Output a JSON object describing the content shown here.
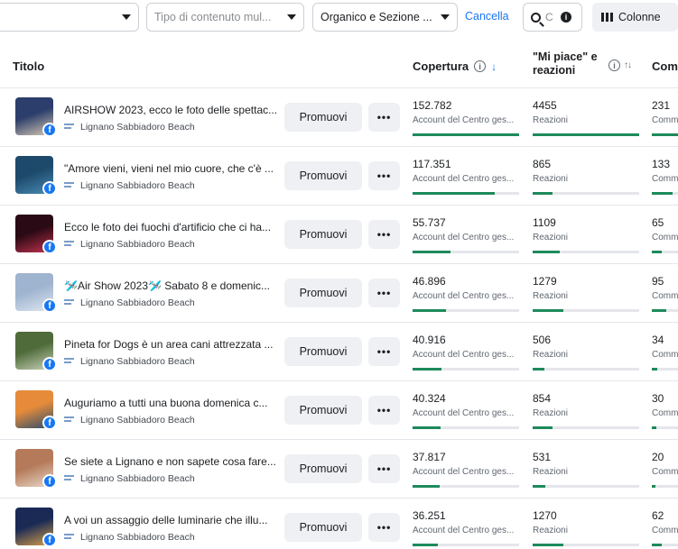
{
  "toolbar": {
    "dropdown1": "",
    "dropdown2": "Tipo di contenuto mul...",
    "dropdown3": "Organico e Sezione ...",
    "cancel": "Cancella",
    "search_placeholder": "Cerca",
    "columns": "Colonne"
  },
  "header": {
    "title": "Titolo",
    "coverage": "Copertura",
    "likes": "\"Mi piace\" e reazioni",
    "comments": "Commenti"
  },
  "labels": {
    "promote": "Promuovi",
    "more": "•••",
    "coverage_sub": "Account del Centro ges...",
    "likes_sub": "Reazioni",
    "comments_sub": "Commenti"
  },
  "rows": [
    {
      "title": "AIRSHOW 2023, ecco le foto delle spettac...",
      "page": "Lignano Sabbiadoro Beach",
      "coverage": "152.782",
      "coverage_pct": 100,
      "likes": "4455",
      "likes_pct": 100,
      "comments": "231",
      "comments_pct": 100,
      "thumb": [
        "#2c3e6b",
        "#d9c9b4"
      ]
    },
    {
      "title": "\"Amore vieni, vieni nel mio cuore, che c'è ...",
      "page": "Lignano Sabbiadoro Beach",
      "coverage": "117.351",
      "coverage_pct": 77,
      "likes": "865",
      "likes_pct": 19,
      "comments": "133",
      "comments_pct": 58,
      "thumb": [
        "#1d4a6b",
        "#4a8ab5"
      ]
    },
    {
      "title": "Ecco le foto dei fuochi d'artificio che ci ha...",
      "page": "Lignano Sabbiadoro Beach",
      "coverage": "55.737",
      "coverage_pct": 36,
      "likes": "1109",
      "likes_pct": 25,
      "comments": "65",
      "comments_pct": 28,
      "thumb": [
        "#2a0a14",
        "#c2324f"
      ]
    },
    {
      "title": "🛩️Air Show 2023🛩️ Sabato 8 e domenic...",
      "page": "Lignano Sabbiadoro Beach",
      "coverage": "46.896",
      "coverage_pct": 31,
      "likes": "1279",
      "likes_pct": 29,
      "comments": "95",
      "comments_pct": 41,
      "thumb": [
        "#9fb4cf",
        "#dfe7f1"
      ]
    },
    {
      "title": "Pineta for Dogs è un area cani attrezzata ...",
      "page": "Lignano Sabbiadoro Beach",
      "coverage": "40.916",
      "coverage_pct": 27,
      "likes": "506",
      "likes_pct": 11,
      "comments": "34",
      "comments_pct": 15,
      "thumb": [
        "#4f6b3a",
        "#c9d2b8"
      ]
    },
    {
      "title": "Auguriamo a tutti una buona domenica c...",
      "page": "Lignano Sabbiadoro Beach",
      "coverage": "40.324",
      "coverage_pct": 26,
      "likes": "854",
      "likes_pct": 19,
      "comments": "30",
      "comments_pct": 13,
      "thumb": [
        "#e58b3a",
        "#2b4c6e"
      ]
    },
    {
      "title": "Se siete a Lignano e non sapete cosa fare...",
      "page": "Lignano Sabbiadoro Beach",
      "coverage": "37.817",
      "coverage_pct": 25,
      "likes": "531",
      "likes_pct": 12,
      "comments": "20",
      "comments_pct": 9,
      "thumb": [
        "#b57a5a",
        "#e8d8c8"
      ]
    },
    {
      "title": "A voi un assaggio delle luminarie che illu...",
      "page": "Lignano Sabbiadoro Beach",
      "coverage": "36.251",
      "coverage_pct": 24,
      "likes": "1270",
      "likes_pct": 29,
      "comments": "62",
      "comments_pct": 27,
      "thumb": [
        "#1a2a55",
        "#d8a048"
      ]
    }
  ]
}
